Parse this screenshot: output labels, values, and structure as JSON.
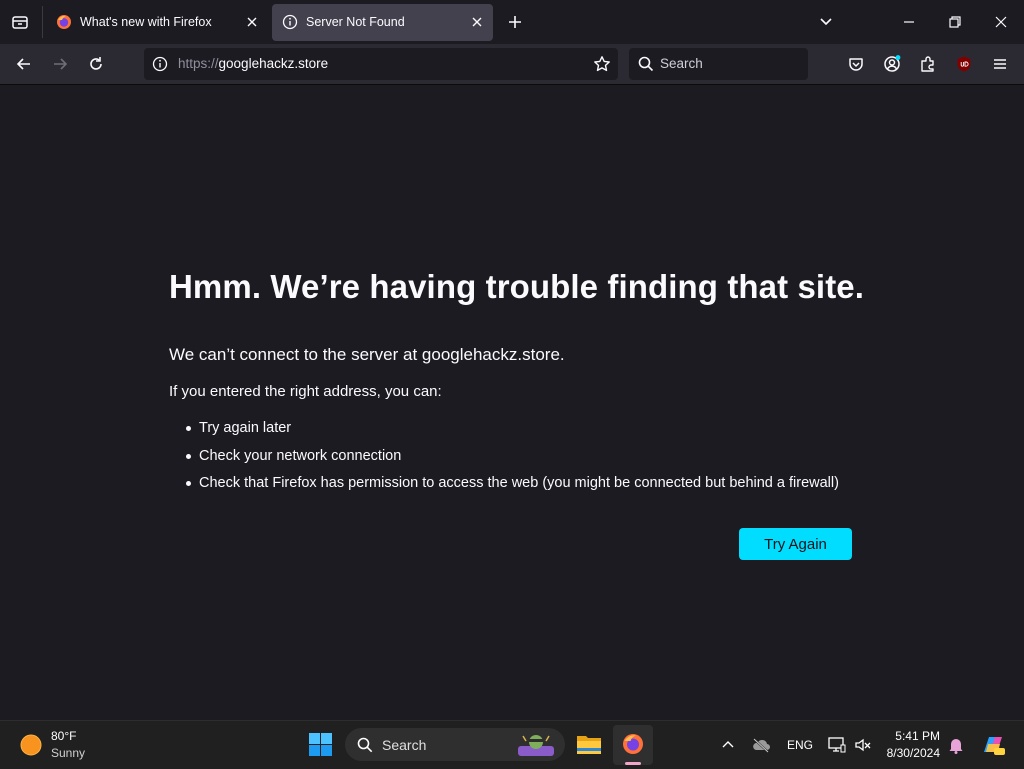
{
  "browser": {
    "tabs": [
      {
        "title": "What's new with Firefox",
        "active": false,
        "favicon": "firefox-icon"
      },
      {
        "title": "Server Not Found",
        "active": true,
        "favicon": "info-icon"
      }
    ],
    "url": {
      "scheme": "https://",
      "host": "googlehackz.store"
    },
    "search_placeholder": "Search",
    "icons": [
      "list-all-tabs-icon",
      "new-tab-icon",
      "tab-overflow-chevron-icon",
      "minimize-icon",
      "restore-icon",
      "close-window-icon",
      "back-icon",
      "forward-icon",
      "reload-icon",
      "site-info-icon",
      "bookmark-star-icon",
      "search-icon",
      "pocket-icon",
      "account-icon",
      "extensions-icon",
      "ublock-icon",
      "menu-icon"
    ]
  },
  "error_page": {
    "title": "Hmm. We’re having trouble finding that site.",
    "subtitle": "We can’t connect to the server at googlehackz.store.",
    "lead": "If you entered the right address, you can:",
    "suggestions": [
      "Try again later",
      "Check your network connection",
      "Check that Firefox has permission to access the web (you might be connected but behind a firewall)"
    ],
    "try_again_label": "Try Again"
  },
  "taskbar": {
    "weather": {
      "temp": "80°F",
      "condition": "Sunny"
    },
    "search_label": "Search",
    "language": "ENG",
    "time": "5:41 PM",
    "date": "8/30/2024"
  },
  "colors": {
    "accent": "#00ddff",
    "page_bg": "#1c1b22",
    "toolbar_bg": "#2b2a33",
    "taskbar_bg": "#202020"
  }
}
